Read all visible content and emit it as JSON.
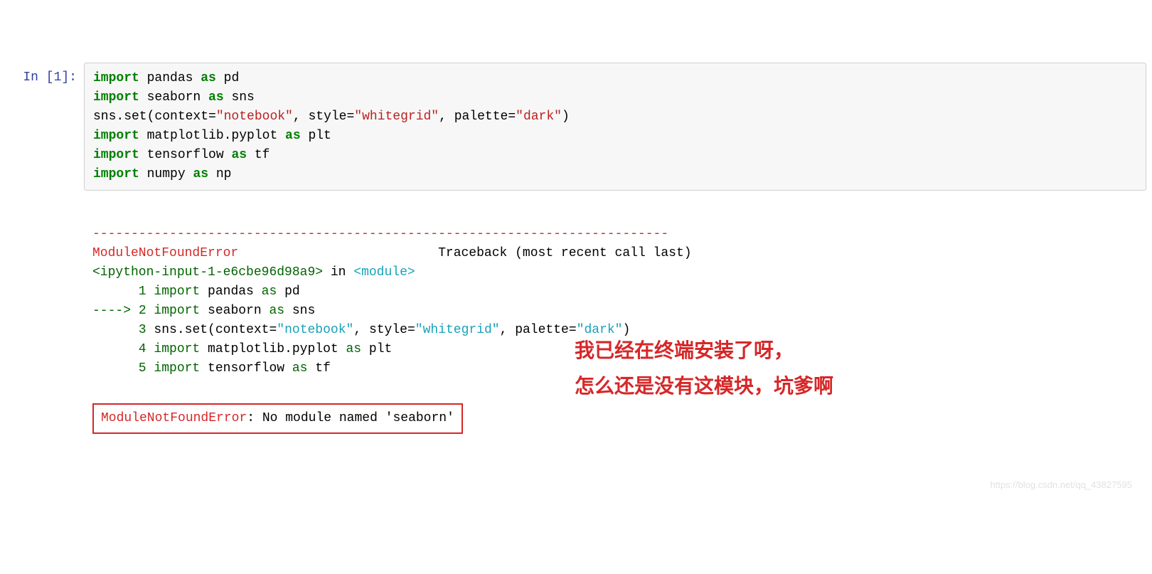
{
  "prompt": "In [1]:",
  "code": {
    "l1_import": "import",
    "l1_mod": " pandas ",
    "l1_as": "as",
    "l1_alias": " pd",
    "l2_import": "import",
    "l2_mod": " seaborn ",
    "l2_as": "as",
    "l2_alias": " sns",
    "l3_prefix": "sns.set(context=",
    "l3_s1": "\"notebook\"",
    "l3_mid1": ", style=",
    "l3_s2": "\"whitegrid\"",
    "l3_mid2": ", palette=",
    "l3_s3": "\"dark\"",
    "l3_close": ")",
    "l4_import": "import",
    "l4_mod": " matplotlib.pyplot ",
    "l4_as": "as",
    "l4_alias": " plt",
    "l5_import": "import",
    "l5_mod": " tensorflow ",
    "l5_as": "as",
    "l5_alias": " tf",
    "l6_import": "import",
    "l6_mod": " numpy ",
    "l6_as": "as",
    "l6_alias": " np"
  },
  "output": {
    "dashline": "---------------------------------------------------------------------------",
    "err_name": "ModuleNotFoundError",
    "spacer": "                          ",
    "traceback_label": "Traceback (most recent call last)",
    "ipy_input": "<ipython-input-1-e6cbe96d98a9>",
    "in_word": " in ",
    "module_word": "<module>",
    "ln1_no": "      1 ",
    "ln1_import": "import",
    "ln1_mod": " pandas ",
    "ln1_as": "as",
    "ln1_alias": " pd",
    "arrow": "----> ",
    "ln2_no": "2 ",
    "ln2_import": "import",
    "ln2_mod": " seaborn ",
    "ln2_as": "as",
    "ln2_alias": " sns",
    "ln3_no": "      3 ",
    "ln3_prefix": "sns",
    "ln3_dot": ".",
    "ln3_set": "set",
    "ln3_paren_o": "(",
    "ln3_ctx_k": "context",
    "ln3_eq1": "=",
    "ln3_ctx_v": "\"notebook\"",
    "ln3_c1": ", ",
    "ln3_sty_k": "style",
    "ln3_eq2": "=",
    "ln3_sty_v": "\"whitegrid\"",
    "ln3_c2": ", ",
    "ln3_pal_k": "palette",
    "ln3_eq3": "=",
    "ln3_pal_v": "\"dark\"",
    "ln3_paren_c": ")",
    "ln4_no": "      4 ",
    "ln4_import": "import",
    "ln4_mod": " matplotlib",
    "ln4_dot": ".",
    "ln4_pyplot": "pyplot ",
    "ln4_as": "as",
    "ln4_alias": " plt",
    "ln5_no": "      5 ",
    "ln5_import": "import",
    "ln5_mod": " tensorflow ",
    "ln5_as": "as",
    "ln5_alias": " tf",
    "final_err_name": "ModuleNotFoundError",
    "final_err_msg": ": No module named 'seaborn'"
  },
  "annotations": {
    "line1": "我已经在终端安装了呀，",
    "line2": "怎么还是没有这模块，坑爹啊"
  },
  "watermark": "https://blog.csdn.net/qq_43827595"
}
